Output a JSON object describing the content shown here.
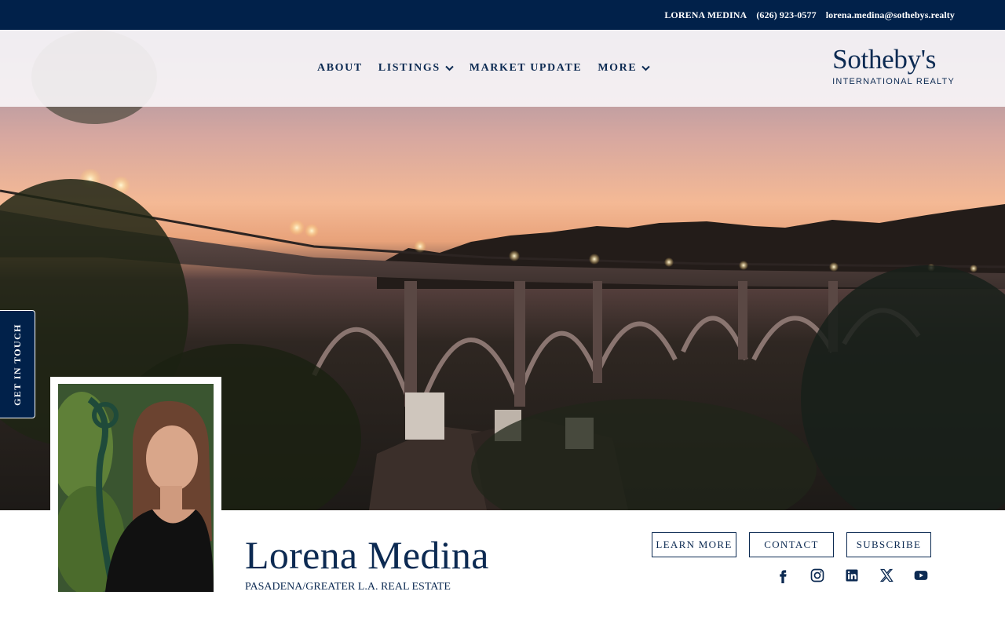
{
  "topbar": {
    "agent": "LORENA MEDINA",
    "phone": "(626) 923-0577",
    "email": "lorena.medina@sothebys.realty"
  },
  "nav": {
    "items": [
      {
        "label": "ABOUT",
        "has_dropdown": false
      },
      {
        "label": "LISTINGS",
        "has_dropdown": true
      },
      {
        "label": "MARKET UPDATE",
        "has_dropdown": false
      },
      {
        "label": "MORE",
        "has_dropdown": true
      }
    ]
  },
  "brand": {
    "name": "Sotheby's",
    "subtitle": "INTERNATIONAL REALTY"
  },
  "side_tab": {
    "label": "GET IN TOUCH"
  },
  "agent": {
    "name": "Lorena Medina",
    "tagline": "PASADENA/GREATER L.A. REAL ESTATE"
  },
  "actions": {
    "learn_more": "LEARN MORE",
    "contact": "CONTACT",
    "subscribe": "SUBSCRIBE"
  },
  "social_icons": [
    "facebook-icon",
    "instagram-icon",
    "linkedin-icon",
    "x-icon",
    "youtube-icon"
  ],
  "colors": {
    "navy": "#01214a",
    "accent_text": "#0c2a52",
    "white": "#ffffff"
  }
}
